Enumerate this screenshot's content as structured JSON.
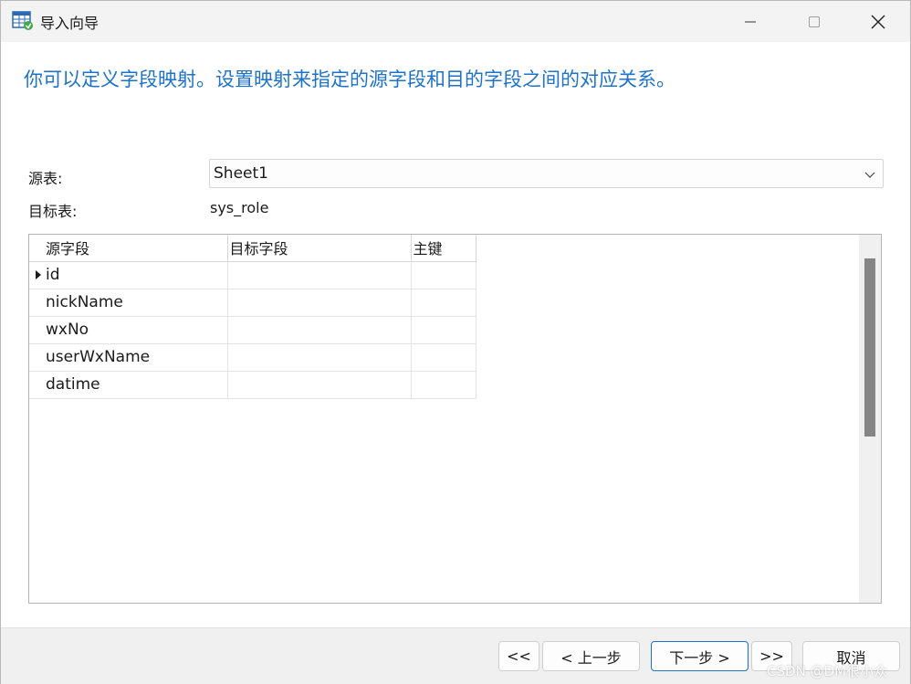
{
  "window": {
    "title": "导入向导",
    "controls": {
      "minimize": "minimize-icon",
      "maximize": "maximize-icon",
      "close": "close-icon"
    }
  },
  "header": {
    "text": "你可以定义字段映射。设置映射来指定的源字段和目的字段之间的对应关系。"
  },
  "form": {
    "source_label": "源表:",
    "source_value": "Sheet1",
    "target_label": "目标表:",
    "target_value": "sys_role"
  },
  "grid": {
    "columns": [
      "源字段",
      "目标字段",
      "主键"
    ],
    "rows": [
      {
        "source": "id",
        "target": "",
        "pk": "",
        "current": true
      },
      {
        "source": "nickName",
        "target": "",
        "pk": ""
      },
      {
        "source": "wxNo",
        "target": "",
        "pk": ""
      },
      {
        "source": "userWxName",
        "target": "",
        "pk": ""
      },
      {
        "source": "datime",
        "target": "",
        "pk": ""
      }
    ]
  },
  "buttons": {
    "first": "<<",
    "prev": "< 上一步",
    "next": "下一步 >",
    "last": ">>",
    "cancel": "取消"
  },
  "watermark": "CSDN @DM很小众",
  "colors": {
    "accent": "#1e73c8",
    "footer_bg": "#f0f0f0",
    "titlebar_bg": "#f3f3f3"
  }
}
